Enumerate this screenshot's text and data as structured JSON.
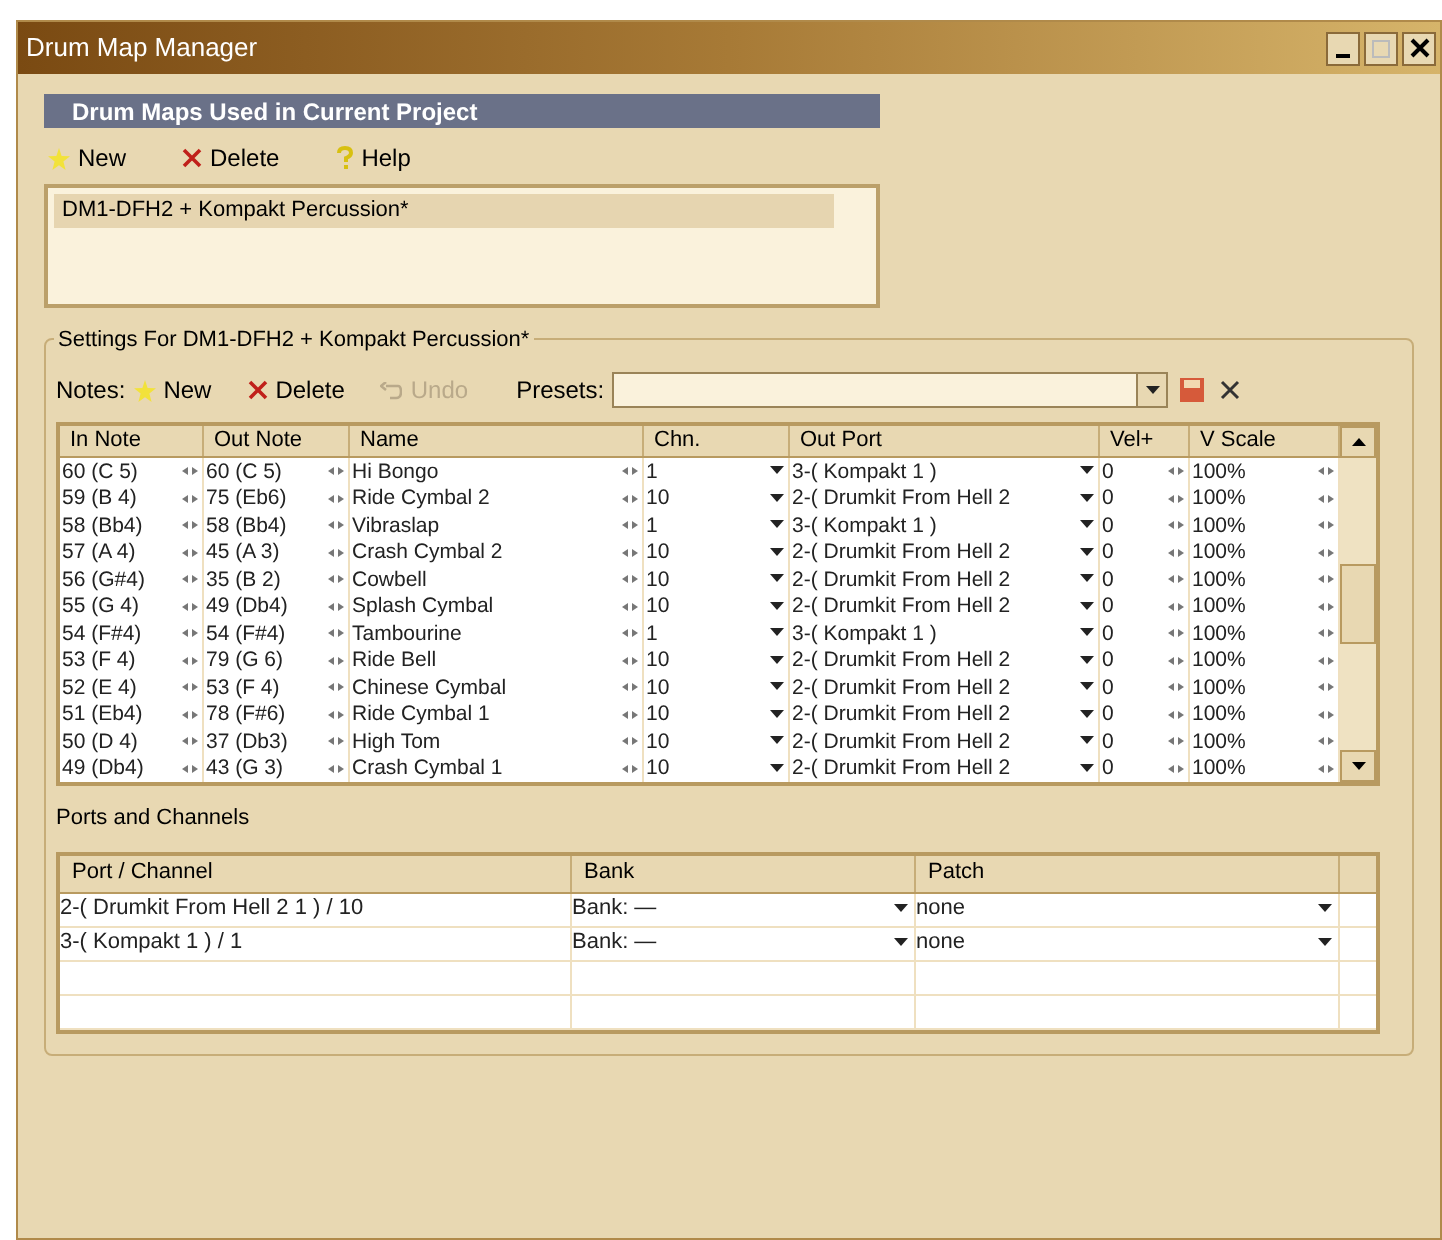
{
  "window": {
    "title": "Drum Map Manager"
  },
  "maps_section": {
    "title": "Drum Maps Used in Current Project",
    "toolbar": [
      {
        "kind": "new",
        "label": "New",
        "disabled": false
      },
      {
        "kind": "delete",
        "label": "Delete",
        "disabled": false
      },
      {
        "kind": "help",
        "label": "Help",
        "disabled": false
      }
    ],
    "items": [
      {
        "label": "DM1-DFH2 + Kompakt Percussion*",
        "selected": true
      }
    ]
  },
  "settings": {
    "title": "Settings For DM1-DFH2 + Kompakt Percussion*",
    "notes_label": "Notes:",
    "toolbar": [
      {
        "kind": "new",
        "label": "New",
        "disabled": false
      },
      {
        "kind": "delete",
        "label": "Delete",
        "disabled": false
      },
      {
        "kind": "undo",
        "label": "Undo",
        "disabled": true
      }
    ],
    "presets_label": "Presets:",
    "table": {
      "columns": [
        "In Note",
        "Out Note",
        "Name",
        "Chn.",
        "Out Port",
        "Vel+",
        "V Scale"
      ],
      "rows": [
        [
          "60 (C 5)",
          "60 (C 5)",
          "Hi Bongo",
          "1",
          "3-( Kompakt 1 )",
          "0",
          "100%"
        ],
        [
          "59 (B 4)",
          "75 (Eb6)",
          "Ride Cymbal 2",
          "10",
          "2-( Drumkit From Hell 2",
          "0",
          "100%"
        ],
        [
          "58 (Bb4)",
          "58 (Bb4)",
          "Vibraslap",
          "1",
          "3-( Kompakt 1 )",
          "0",
          "100%"
        ],
        [
          "57 (A 4)",
          "45 (A 3)",
          "Crash Cymbal 2",
          "10",
          "2-( Drumkit From Hell 2",
          "0",
          "100%"
        ],
        [
          "56 (G#4)",
          "35 (B 2)",
          "Cowbell",
          "10",
          "2-( Drumkit From Hell 2",
          "0",
          "100%"
        ],
        [
          "55 (G 4)",
          "49 (Db4)",
          "Splash Cymbal",
          "10",
          "2-( Drumkit From Hell 2",
          "0",
          "100%"
        ],
        [
          "54 (F#4)",
          "54 (F#4)",
          "Tambourine",
          "1",
          "3-( Kompakt 1 )",
          "0",
          "100%"
        ],
        [
          "53 (F 4)",
          "79 (G 6)",
          "Ride Bell",
          "10",
          "2-( Drumkit From Hell 2",
          "0",
          "100%"
        ],
        [
          "52 (E 4)",
          "53 (F 4)",
          "Chinese Cymbal",
          "10",
          "2-( Drumkit From Hell 2",
          "0",
          "100%"
        ],
        [
          "51 (Eb4)",
          "78 (F#6)",
          "Ride Cymbal 1",
          "10",
          "2-( Drumkit From Hell 2",
          "0",
          "100%"
        ],
        [
          "50 (D 4)",
          "37 (Db3)",
          "High Tom",
          "10",
          "2-( Drumkit From Hell 2",
          "0",
          "100%"
        ],
        [
          "49 (Db4)",
          "43 (G 3)",
          "Crash Cymbal 1",
          "10",
          "2-( Drumkit From Hell 2",
          "0",
          "100%"
        ]
      ]
    }
  },
  "ports": {
    "title": "Ports and Channels",
    "columns": [
      "Port / Channel",
      "Bank",
      "Patch"
    ],
    "rows": [
      [
        "2-( Drumkit From Hell 2 1 ) / 10",
        "Bank: —",
        "none"
      ],
      [
        "3-( Kompakt 1 ) / 1",
        "Bank: —",
        "none"
      ]
    ]
  }
}
